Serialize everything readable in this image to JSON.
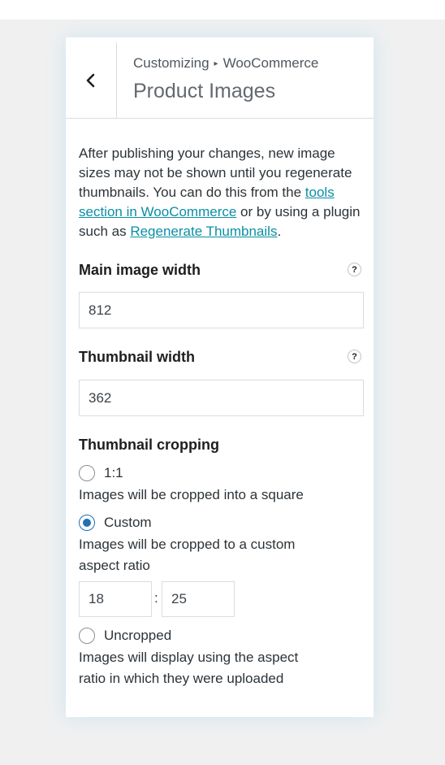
{
  "header": {
    "breadcrumb_root": "Customizing",
    "breadcrumb_separator": "▸",
    "breadcrumb_section": "WooCommerce",
    "title": "Product Images"
  },
  "description": {
    "text_1": "After publishing your changes, new image sizes may not be shown until you regenerate thumbnails. You can do this from the ",
    "link_1": "tools section in WooCommerce",
    "text_2": " or by using a plugin such as ",
    "link_2": "Regenerate Thumbnails",
    "text_3": "."
  },
  "main_image_width": {
    "label": "Main image width",
    "help": "?",
    "value": "812"
  },
  "thumbnail_width": {
    "label": "Thumbnail width",
    "help": "?",
    "value": "362"
  },
  "thumbnail_cropping": {
    "label": "Thumbnail cropping",
    "options": [
      {
        "label": "1:1",
        "description": "Images will be cropped into a square",
        "checked": false
      },
      {
        "label": "Custom",
        "description": "Images will be cropped to a custom aspect ratio",
        "checked": true
      },
      {
        "label": "Uncropped",
        "description": "Images will display using the aspect ratio in which they were uploaded",
        "checked": false
      }
    ],
    "custom_width": "18",
    "ratio_separator": ":",
    "custom_height": "25"
  },
  "colors": {
    "link": "#0a8fa4",
    "radio_checked": "#2271b1"
  }
}
